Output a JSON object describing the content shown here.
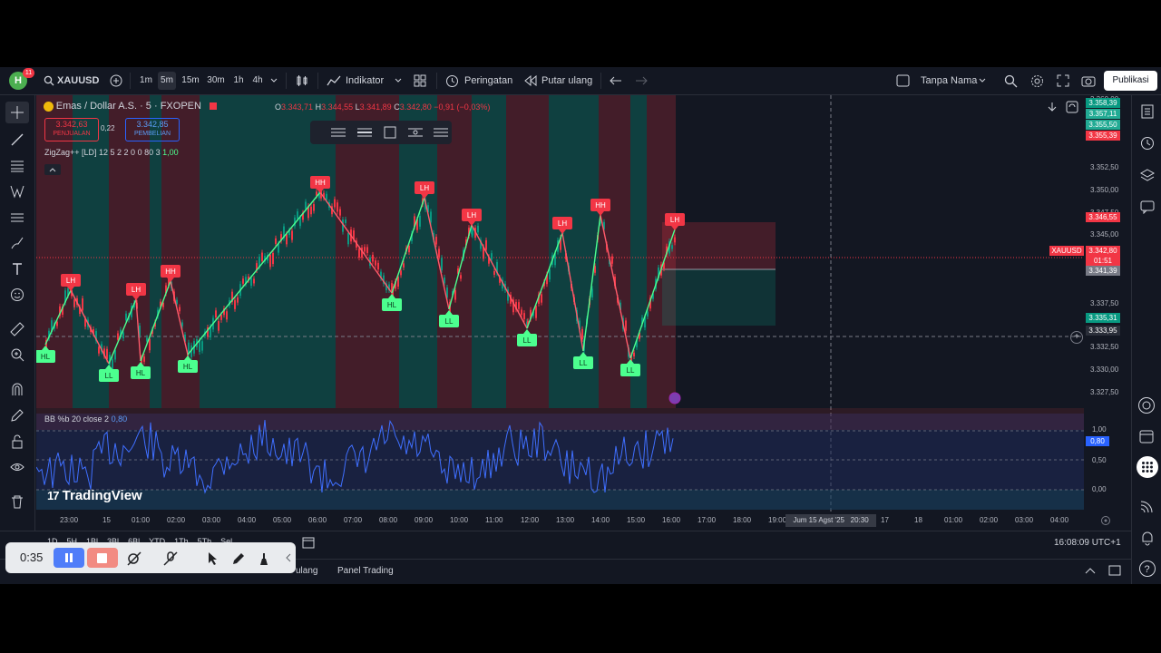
{
  "topbar": {
    "avatar_letter": "H",
    "notif_count": "11",
    "symbol": "XAUUSD",
    "intervals": [
      "1m",
      "5m",
      "15m",
      "30m",
      "1h",
      "4h"
    ],
    "selected_interval": "5m",
    "indicators_label": "Indikator",
    "alert_label": "Peringatan",
    "replay_label": "Putar ulang",
    "layout_name": "Tanpa Nama",
    "publish_label": "Publikasi"
  },
  "legend": {
    "title": "Emas / Dollar A.S. · 5 · FXOPEN",
    "o_label": "O",
    "o": "3.343,71",
    "h_label": "H",
    "h": "3.344,55",
    "l_label": "L",
    "l": "3.341,89",
    "c_label": "C",
    "c": "3.342,80",
    "change": "−0,91 (−0,03%)",
    "sell_price": "3.342,63",
    "sell_label": "PENJUALAN",
    "spread": "0,22",
    "buy_price": "3.342,85",
    "buy_label": "PEMBELIAN",
    "zigzag": "ZigZag++ [LD] 12 5 2 2 0 0 80 3",
    "zigzag_value": "1,00",
    "bb_label": "BB %b 20 close 2",
    "bb_value": "0,80"
  },
  "price_scale": {
    "ticks": [
      "3.360,00",
      "3.352,50",
      "3.350,00",
      "3.347,50",
      "3.345,00",
      "3.337,50",
      "3.332,50",
      "3.330,00",
      "3.327,50"
    ],
    "tags": [
      {
        "text": "3.358,39",
        "color": "#089981"
      },
      {
        "text": "3.357,11",
        "color": "#22ab94"
      },
      {
        "text": "3.355,50",
        "color": "#22ab94"
      },
      {
        "text": "3.355,39",
        "color": "#f23645"
      },
      {
        "text": "3.346,55",
        "color": "#f23645"
      },
      {
        "text": "XAUUSD",
        "color": "#f23645"
      },
      {
        "text": "3.342,80",
        "color": "#f23645"
      },
      {
        "text": "01:51",
        "color": "#f23645"
      },
      {
        "text": "3.341,39",
        "color": "#787b86"
      },
      {
        "text": "3.335,31",
        "color": "#089981"
      },
      {
        "text": "3.333,95",
        "color": "#2a2e39"
      }
    ],
    "osc_ticks": [
      "1,00",
      "0,50",
      "0,00"
    ],
    "osc_tag": "0,80"
  },
  "time_axis": {
    "ticks": [
      "23:00",
      "15",
      "01:00",
      "02:00",
      "03:00",
      "04:00",
      "05:00",
      "06:00",
      "07:00",
      "08:00",
      "09:00",
      "10:00",
      "11:00",
      "12:00",
      "13:00",
      "14:00",
      "15:00",
      "16:00",
      "17:00",
      "18:00",
      "19:00",
      "17",
      "18",
      "01:00",
      "02:00",
      "03:00",
      "04:00"
    ],
    "crosshair_label": "Jum 15 Agst '25",
    "crosshair_time": "20:30"
  },
  "swing_labels": [
    {
      "text": "HL",
      "type": "low"
    },
    {
      "text": "LH",
      "type": "high"
    },
    {
      "text": "LL",
      "type": "low"
    },
    {
      "text": "LH",
      "type": "high"
    },
    {
      "text": "HL",
      "type": "low"
    },
    {
      "text": "HH",
      "type": "high"
    },
    {
      "text": "HL",
      "type": "low"
    },
    {
      "text": "HH",
      "type": "high"
    },
    {
      "text": "HL",
      "type": "low"
    },
    {
      "text": "LH",
      "type": "high"
    },
    {
      "text": "LL",
      "type": "low"
    },
    {
      "text": "LH",
      "type": "high"
    },
    {
      "text": "LL",
      "type": "low"
    },
    {
      "text": "LH",
      "type": "high"
    },
    {
      "text": "LL",
      "type": "low"
    },
    {
      "text": "HH",
      "type": "high"
    },
    {
      "text": "LL",
      "type": "low"
    },
    {
      "text": "LH",
      "type": "high"
    }
  ],
  "watermark": "TradingView",
  "bottom": {
    "clock": "16:08:09 UTC+1",
    "range_buttons": [
      "1D",
      "5H",
      "1Bl",
      "3Bl",
      "6Bl",
      "YTD",
      "1Th",
      "5Th",
      "Sel"
    ],
    "panel_trading": "Panel Trading",
    "tab_partial": "ulang"
  },
  "recorder": {
    "time": "0:35"
  },
  "colors": {
    "up": "#089981",
    "down": "#f23645",
    "zz_up": "#4cff8f",
    "zz_down": "#ff5a6a",
    "accent": "#2962ff"
  }
}
